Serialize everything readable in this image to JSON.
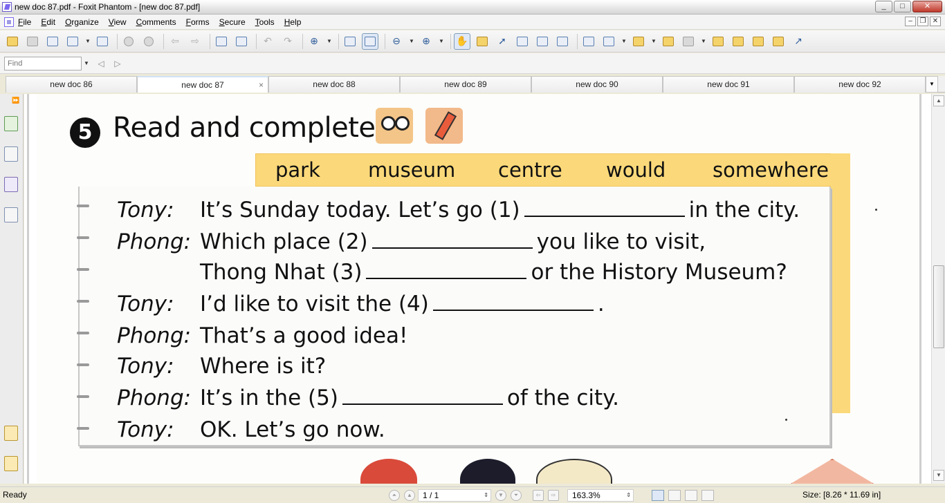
{
  "window": {
    "title": "new doc 87.pdf - Foxit Phantom - [new doc 87.pdf]",
    "controls": {
      "minimize": "_",
      "maximize": "□",
      "close": "✕"
    }
  },
  "menubar": {
    "items": [
      "File",
      "Edit",
      "Organize",
      "View",
      "Comments",
      "Forms",
      "Secure",
      "Tools",
      "Help"
    ],
    "mdi": {
      "minimize": "–",
      "restore": "❐",
      "close": "✕"
    }
  },
  "find": {
    "placeholder": "Find"
  },
  "tabs": {
    "items": [
      {
        "label": "new doc 86"
      },
      {
        "label": "new doc 87",
        "active": true
      },
      {
        "label": "new doc 88"
      },
      {
        "label": "new doc 89"
      },
      {
        "label": "new doc 90"
      },
      {
        "label": "new doc 91"
      },
      {
        "label": "new doc 92"
      }
    ],
    "close_glyph": "×",
    "dropdown": "▼"
  },
  "document": {
    "exercise_number": "5",
    "exercise_title": "Read and complete.",
    "word_bank": [
      "park",
      "museum",
      "centre",
      "would",
      "somewhere"
    ],
    "dialogue": [
      {
        "speaker": "Tony:",
        "before": "It’s Sunday today. Let’s go (1)",
        "after": "in the city."
      },
      {
        "speaker": "Phong:",
        "before": "Which place (2)",
        "after": "you like to visit,"
      },
      {
        "speaker": "",
        "before": "Thong Nhat (3)",
        "after": "or the History Museum?"
      },
      {
        "speaker": "Tony:",
        "before": "I’d like to visit the (4)",
        "after": "."
      },
      {
        "speaker": "Phong:",
        "before": "That’s a good idea!",
        "after": ""
      },
      {
        "speaker": "Tony:",
        "before": "Where is it?",
        "after": ""
      },
      {
        "speaker": "Phong:",
        "before": "It’s in the (5)",
        "after": "of the city."
      },
      {
        "speaker": "Tony:",
        "before": "OK. Let’s go now.",
        "after": ""
      }
    ]
  },
  "statusbar": {
    "status": "Ready",
    "page": "1 / 1",
    "zoom": "163.3%",
    "size": "Size: [8.26 * 11.69 in]"
  },
  "colors": {
    "word_bank_bg": "#fbd97a",
    "accent_blue": "#2e5c9a",
    "close_red": "#c0392b"
  }
}
